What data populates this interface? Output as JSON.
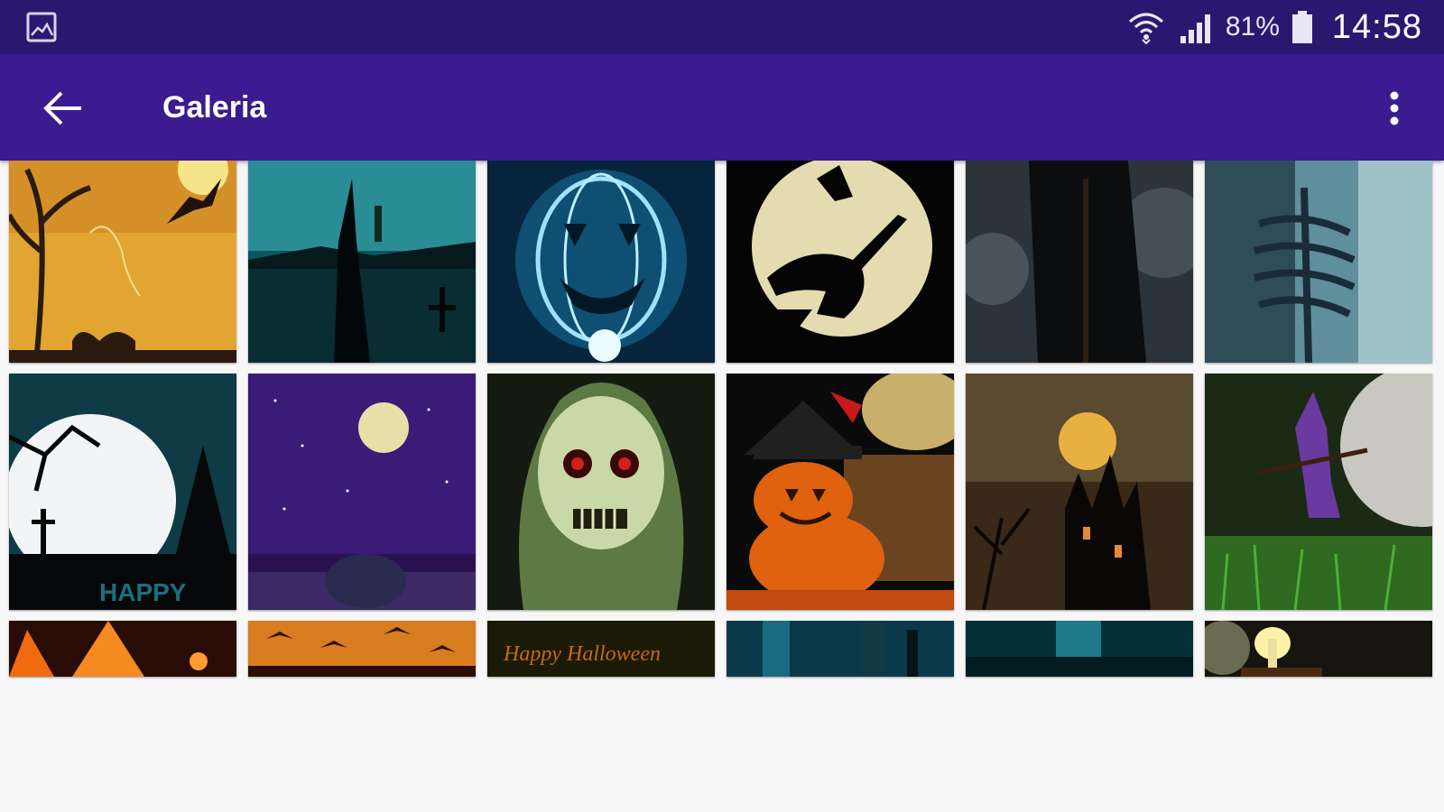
{
  "status_bar": {
    "battery_percent": "81%",
    "time": "14:58",
    "icons": [
      "gallery-notification-icon",
      "wifi-icon",
      "signal-icon",
      "battery-icon"
    ]
  },
  "app_bar": {
    "title": "Galeria",
    "back_icon": "arrow-back-icon",
    "menu_icon": "more-vert-icon"
  },
  "gallery": {
    "rows": [
      [
        {
          "name": "witch-tree-bat-yellow"
        },
        {
          "name": "witch-silhouette-lake"
        },
        {
          "name": "glowing-blue-pumpkin"
        },
        {
          "name": "witch-on-broom-moon"
        },
        {
          "name": "hooded-reaper-dark"
        },
        {
          "name": "skeleton-blue"
        }
      ],
      [
        {
          "name": "moon-graveyard",
          "caption": "HAPPY"
        },
        {
          "name": "purple-sky-moon"
        },
        {
          "name": "green-skull"
        },
        {
          "name": "jack-o-lantern-hat"
        },
        {
          "name": "castle-moon"
        },
        {
          "name": "witch-green-grass"
        }
      ],
      [
        {
          "name": "orange-glow"
        },
        {
          "name": "bats-orange"
        },
        {
          "name": "happy-halloween-text",
          "caption": "Happy Halloween"
        },
        {
          "name": "blue-forest"
        },
        {
          "name": "teal-lights"
        },
        {
          "name": "candle-dark"
        }
      ]
    ]
  },
  "colors": {
    "status_bar": "#2a1870",
    "app_bar": "#3b1b8f",
    "background": "#f7f7f7"
  }
}
